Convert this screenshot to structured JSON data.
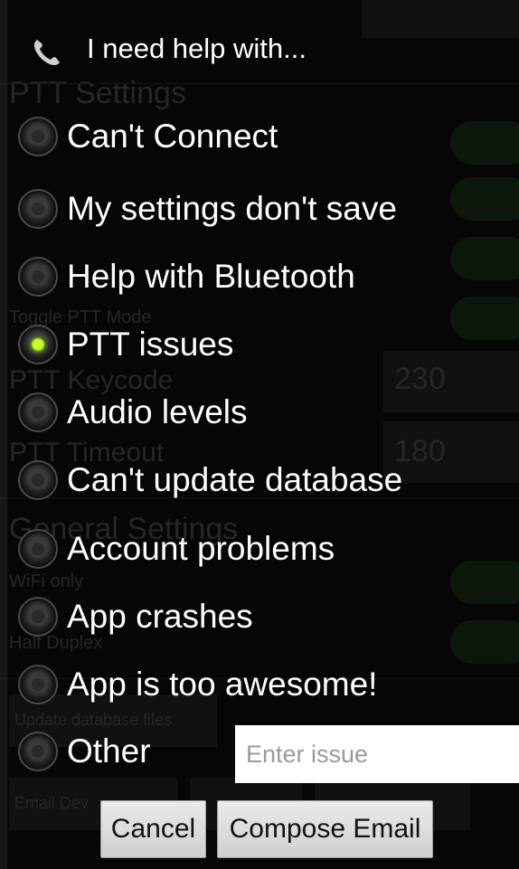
{
  "background": {
    "sections": [
      "PTT Settings",
      "General Settings"
    ],
    "labels": [
      "Toggle PTT Mode",
      "PTT Keycode",
      "PTT Timeout",
      "WiFi only",
      "Half Duplex"
    ],
    "fields": [
      "230",
      "180"
    ],
    "buttons": [
      "Update database files",
      "Email Dev"
    ]
  },
  "dialog": {
    "title": "I need help with...",
    "options": [
      {
        "label": "Can't Connect",
        "selected": false
      },
      {
        "label": "My settings don't save",
        "selected": false
      },
      {
        "label": "Help with Bluetooth",
        "selected": false
      },
      {
        "label": "PTT issues",
        "selected": true
      },
      {
        "label": "Audio levels",
        "selected": false
      },
      {
        "label": "Can't update database",
        "selected": false
      },
      {
        "label": "Account problems",
        "selected": false
      },
      {
        "label": "App crashes",
        "selected": false
      },
      {
        "label": "App is too awesome!",
        "selected": false
      },
      {
        "label": "Other",
        "selected": false
      }
    ],
    "issue_input": {
      "value": "",
      "placeholder": "Enter issue"
    },
    "cancel_label": "Cancel",
    "compose_label": "Compose Email"
  },
  "colors": {
    "accent": "#a6ff00",
    "background": "#000000"
  }
}
